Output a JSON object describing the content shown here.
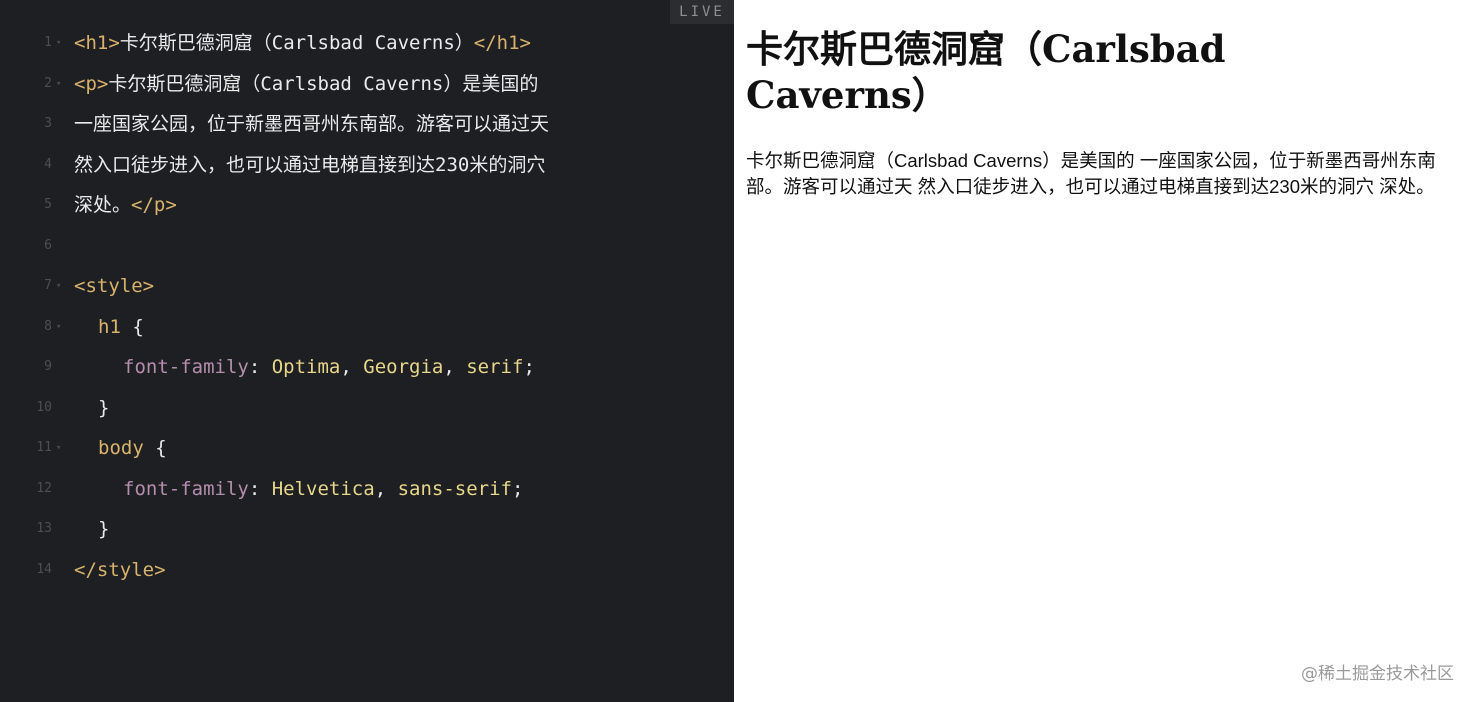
{
  "editor": {
    "badge": "LIVE",
    "lines": [
      {
        "num": "1",
        "fold": "▾",
        "parts": [
          {
            "t": "<h1>",
            "c": "tag"
          },
          {
            "t": "卡尔斯巴德洞窟（Carlsbad Caverns）",
            "c": "plain"
          },
          {
            "t": "</h1>",
            "c": "tag"
          }
        ]
      },
      {
        "num": "2",
        "fold": "▾",
        "parts": [
          {
            "t": "<p>",
            "c": "tag"
          },
          {
            "t": "卡尔斯巴德洞窟（Carlsbad Caverns）是美国的",
            "c": "plain"
          }
        ]
      },
      {
        "num": "3",
        "fold": "",
        "parts": [
          {
            "t": "一座国家公园，位于新墨西哥州东南部。游客可以通过天",
            "c": "plain"
          }
        ]
      },
      {
        "num": "4",
        "fold": "",
        "parts": [
          {
            "t": "然入口徒步进入，也可以通过电梯直接到达230米的洞穴",
            "c": "plain"
          }
        ]
      },
      {
        "num": "5",
        "fold": "",
        "parts": [
          {
            "t": "深处。",
            "c": "plain"
          },
          {
            "t": "</p>",
            "c": "tag"
          }
        ]
      },
      {
        "num": "6",
        "fold": "",
        "parts": []
      },
      {
        "num": "7",
        "fold": "▾",
        "parts": [
          {
            "t": "<style>",
            "c": "tag"
          }
        ]
      },
      {
        "num": "8",
        "fold": "▾",
        "indent": 1,
        "parts": [
          {
            "t": "h1",
            "c": "tag"
          },
          {
            "t": " {",
            "c": "punc"
          }
        ]
      },
      {
        "num": "9",
        "fold": "",
        "indent": 2,
        "parts": [
          {
            "t": "font-family",
            "c": "prop"
          },
          {
            "t": ": ",
            "c": "punc"
          },
          {
            "t": "Optima",
            "c": "val"
          },
          {
            "t": ", ",
            "c": "punc"
          },
          {
            "t": "Georgia",
            "c": "val"
          },
          {
            "t": ", ",
            "c": "punc"
          },
          {
            "t": "serif",
            "c": "val"
          },
          {
            "t": ";",
            "c": "punc"
          }
        ]
      },
      {
        "num": "10",
        "fold": "",
        "indent": 1,
        "parts": [
          {
            "t": "}",
            "c": "punc"
          }
        ]
      },
      {
        "num": "11",
        "fold": "▾",
        "indent": 1,
        "parts": [
          {
            "t": "body",
            "c": "tag"
          },
          {
            "t": " {",
            "c": "punc"
          }
        ]
      },
      {
        "num": "12",
        "fold": "",
        "indent": 2,
        "parts": [
          {
            "t": "font-family",
            "c": "prop"
          },
          {
            "t": ": ",
            "c": "punc"
          },
          {
            "t": "Helvetica",
            "c": "val"
          },
          {
            "t": ", ",
            "c": "punc"
          },
          {
            "t": "sans-serif",
            "c": "val"
          },
          {
            "t": ";",
            "c": "punc"
          }
        ]
      },
      {
        "num": "13",
        "fold": "",
        "indent": 1,
        "parts": [
          {
            "t": "}",
            "c": "punc"
          }
        ]
      },
      {
        "num": "14",
        "fold": "",
        "parts": [
          {
            "t": "</style>",
            "c": "tag"
          }
        ]
      }
    ]
  },
  "preview": {
    "heading": "卡尔斯巴德洞窟（Carlsbad Caverns）",
    "paragraph": "卡尔斯巴德洞窟（Carlsbad Caverns）是美国的 一座国家公园，位于新墨西哥州东南部。游客可以通过天 然入口徒步进入，也可以通过电梯直接到达230米的洞穴 深处。"
  },
  "watermark": "@稀土掘金技术社区",
  "colors": {
    "editor_bg": "#1e1f22",
    "tag": "#d9b36c",
    "property": "#b58dae",
    "value": "#e7d68a",
    "text": "#eaeaea",
    "line_number": "#4d4e52"
  }
}
